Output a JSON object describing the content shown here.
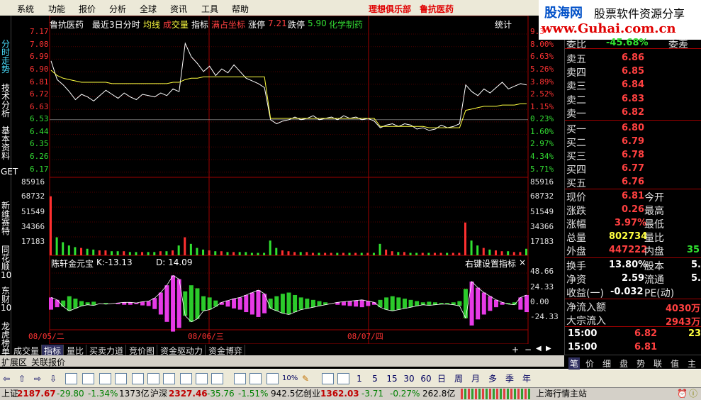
{
  "menu": {
    "items": [
      "系统",
      "功能",
      "报价",
      "分析",
      "全球",
      "资讯",
      "工具",
      "帮助"
    ],
    "title1": "理想俱乐部",
    "title2": "鲁抗医药"
  },
  "logo": {
    "line1": "股海网",
    "line2": "股票软件资源分享",
    "line3": "www.Guhai.com.cn"
  },
  "sidebar": {
    "items": [
      {
        "label": "分时走势",
        "active": true
      },
      {
        "label": "技术分析",
        "active": false
      },
      {
        "label": "基本资料",
        "active": false
      },
      {
        "label": "GET",
        "active": false
      },
      {
        "label": "新维赛特",
        "active": false
      },
      {
        "label": "同花顺10",
        "active": false
      },
      {
        "label": "东财10",
        "active": false
      },
      {
        "label": "龙虎榜单",
        "active": false
      }
    ]
  },
  "chart_header": {
    "name": "鲁抗医药",
    "period": "最近3日分时",
    "avg": "均线",
    "vol1": "成",
    "vol2": "交量",
    "indicator": "指标",
    "coord": "满占坐标",
    "limit_up_label": "涨停",
    "limit_up": "7.21",
    "limit_down_label": "跌停",
    "limit_down": "5.90",
    "sector": "化学制药",
    "stats": "统计"
  },
  "chart_data": {
    "type": "line",
    "title": "鲁抗医药 最近3日分时",
    "price_axis": [
      "7.17",
      "7.08",
      "6.99",
      "6.90",
      "6.81",
      "6.72",
      "6.63",
      "6.53",
      "6.44",
      "6.35",
      "6.26",
      "6.17"
    ],
    "pct_axis": [
      "9.3",
      "8.00%",
      "6.63%",
      "5.26%",
      "3.89%",
      "2.52%",
      "1.15%",
      "0.23%",
      "1.60%",
      "2.97%",
      "4.34%",
      "5.71%"
    ],
    "volume_axis": [
      "85916",
      "68732",
      "51549",
      "34366",
      "17183"
    ],
    "indicator": {
      "name": "陈轩金元宝",
      "k": "K:-13.13",
      "d": "D: 14.09",
      "axis": [
        "48.66",
        "24.33",
        "0.00",
        "-24.33"
      ],
      "hint": "右键设置指标"
    },
    "dates": [
      "08/05/二",
      "08/06/三",
      "08/07/四"
    ],
    "prev_close": 6.55,
    "price_series": [
      6.99,
      6.85,
      6.81,
      6.76,
      6.7,
      6.74,
      6.72,
      6.69,
      6.73,
      6.77,
      6.74,
      6.71,
      6.75,
      6.72,
      6.7,
      6.74,
      6.73,
      6.72,
      6.75,
      6.73,
      6.78,
      6.76,
      7.12,
      7.02,
      6.97,
      6.91,
      6.95,
      6.88,
      6.93,
      6.9,
      6.96,
      6.91,
      6.86,
      6.84,
      6.82,
      6.79,
      6.55,
      6.52,
      6.54,
      6.55,
      6.57,
      6.55,
      6.56,
      6.58,
      6.55,
      6.56,
      6.57,
      6.55,
      6.58,
      6.56,
      6.57,
      6.55,
      6.56,
      6.54,
      6.49,
      6.51,
      6.52,
      6.5,
      6.52,
      6.51,
      6.48,
      6.49,
      6.47,
      6.48,
      6.51,
      6.49,
      6.5,
      6.52,
      6.81,
      6.76,
      6.73,
      6.78,
      6.75,
      6.79,
      6.83,
      6.78,
      6.8,
      6.82,
      6.81
    ],
    "avg_series": [
      6.92,
      6.88,
      6.86,
      6.85,
      6.84,
      6.83,
      6.83,
      6.83,
      6.83,
      6.83,
      6.82,
      6.82,
      6.82,
      6.82,
      6.82,
      6.82,
      6.82,
      6.82,
      6.82,
      6.82,
      6.83,
      6.83,
      6.85,
      6.86,
      6.86,
      6.87,
      6.87,
      6.87,
      6.87,
      6.87,
      6.87,
      6.87,
      6.87,
      6.87,
      6.87,
      6.87,
      6.56,
      6.56,
      6.56,
      6.56,
      6.56,
      6.56,
      6.56,
      6.56,
      6.56,
      6.56,
      6.56,
      6.56,
      6.56,
      6.56,
      6.56,
      6.56,
      6.56,
      6.56,
      6.5,
      6.5,
      6.5,
      6.5,
      6.5,
      6.5,
      6.5,
      6.5,
      6.49,
      6.49,
      6.49,
      6.49,
      6.49,
      6.49,
      6.62,
      6.63,
      6.64,
      6.65,
      6.65,
      6.65,
      6.66,
      6.66,
      6.66,
      6.67,
      6.67
    ],
    "volume_series": [
      72000,
      22000,
      16000,
      12000,
      10000,
      9000,
      8000,
      7000,
      6000,
      6000,
      5000,
      5000,
      5000,
      4000,
      4000,
      4000,
      4000,
      4000,
      5000,
      5000,
      6000,
      12000,
      22000,
      14000,
      9000,
      7000,
      6000,
      5000,
      5000,
      4000,
      4000,
      4000,
      4000,
      3000,
      3000,
      3000,
      18000,
      9000,
      6000,
      5000,
      4000,
      4000,
      4000,
      3000,
      3000,
      3000,
      3000,
      3000,
      3000,
      3000,
      3000,
      3000,
      3000,
      3000,
      14000,
      7000,
      5000,
      4000,
      4000,
      3000,
      3000,
      3000,
      3000,
      3000,
      3000,
      3000,
      3000,
      3000,
      40000,
      18000,
      12000,
      9000,
      7000,
      6000,
      5000,
      5000,
      4000,
      4000,
      8000
    ],
    "indicator_series": [
      10,
      6,
      -5,
      -12,
      -8,
      -4,
      -2,
      -3,
      0,
      -1,
      0,
      1,
      2,
      2,
      1,
      3,
      4,
      9,
      18,
      30,
      46,
      40,
      -20,
      -30,
      -25,
      -12,
      -10,
      -5,
      2,
      5,
      8,
      10,
      14,
      18,
      22,
      16,
      -8,
      -12,
      -16,
      -18,
      -14,
      -10,
      -8,
      -6,
      -4,
      -2,
      0,
      2,
      3,
      4,
      5,
      6,
      4,
      2,
      -6,
      -10,
      -12,
      -10,
      -8,
      -6,
      -4,
      -2,
      -3,
      -2,
      -1,
      -1,
      -2,
      -4,
      -24,
      36,
      26,
      18,
      12,
      6,
      2,
      -1,
      -2,
      10,
      14
    ]
  },
  "bottom_tabs": [
    "成交量",
    "指标",
    "量比",
    "买卖力道",
    "竞价图",
    "资金驱动力",
    "资金博弈"
  ],
  "row2": [
    "扩展区",
    "关联报价"
  ],
  "toolbar": {
    "items": [
      "1",
      "5",
      "15",
      "30",
      "60",
      "日",
      "周",
      "月",
      "多",
      "季",
      "年"
    ]
  },
  "order_book": {
    "wei_label": "委比",
    "wei_value": "-45.68%",
    "wei_cha_label": "委差",
    "sell": [
      {
        "label": "卖五",
        "price": "6.86"
      },
      {
        "label": "卖四",
        "price": "6.85"
      },
      {
        "label": "卖三",
        "price": "6.84"
      },
      {
        "label": "卖二",
        "price": "6.83"
      },
      {
        "label": "卖一",
        "price": "6.82"
      }
    ],
    "buy": [
      {
        "label": "买一",
        "price": "6.80"
      },
      {
        "label": "买二",
        "price": "6.79"
      },
      {
        "label": "买三",
        "price": "6.78"
      },
      {
        "label": "买四",
        "price": "6.77"
      },
      {
        "label": "买五",
        "price": "6.76"
      }
    ]
  },
  "quote": {
    "rows": [
      {
        "l1": "现价",
        "v1": "6.81",
        "c1": "red",
        "l2": "今开",
        "v2": ""
      },
      {
        "l1": "涨跌",
        "v1": "0.26",
        "c1": "red",
        "l2": "最高",
        "v2": ""
      },
      {
        "l1": "涨幅",
        "v1": "3.97%",
        "c1": "red",
        "l2": "最低",
        "v2": ""
      },
      {
        "l1": "总量",
        "v1": "802734",
        "c1": "yel",
        "l2": "量比",
        "v2": ""
      },
      {
        "l1": "外盘",
        "v1": "447222",
        "c1": "red",
        "l2": "内盘",
        "v2": "35"
      }
    ],
    "rows2": [
      {
        "l1": "换手",
        "v1": "13.80%",
        "l2": "股本",
        "v2": "5."
      },
      {
        "l1": "净资",
        "v1": "2.59",
        "l2": "流通",
        "v2": "5."
      },
      {
        "l1": "收益(一)",
        "v1": "-0.032",
        "l2": "PE(动)",
        "v2": ""
      }
    ],
    "flows": [
      {
        "label": "净流入额",
        "value": "4030万"
      },
      {
        "label": "大宗流入",
        "value": "2943万"
      }
    ],
    "ticks": [
      {
        "time": "15:00",
        "price": "6.82",
        "vol": "23"
      },
      {
        "time": "15:00",
        "price": "6.81",
        "vol": ""
      }
    ]
  },
  "right_tabs": [
    "笔",
    "价",
    "细",
    "盘",
    "势",
    "联",
    "值",
    "主"
  ],
  "status": {
    "sh_label": "上证",
    "sh_val": "2187.67",
    "sh_chg": "-29.80",
    "sh_pct": "-1.34%",
    "sh_amt": "1373亿",
    "sz_label": "沪深",
    "sz_val": "2327.46",
    "sz_chg": "-35.76",
    "sz_pct": "-1.51%",
    "sz_amt": "942.5亿",
    "cy_label": "创业",
    "cy_val": "1362.03",
    "cy_chg": "-3.71",
    "cy_pct": "-0.27%",
    "cy_amt": "262.8亿",
    "server": "上海行情主站"
  }
}
